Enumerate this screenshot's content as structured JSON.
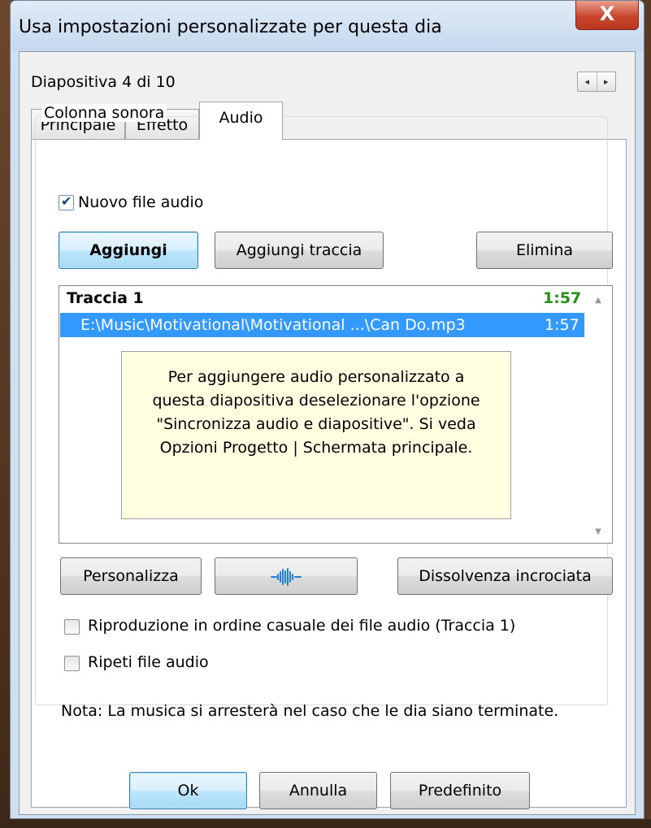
{
  "window": {
    "title": "Usa impostazioni personalizzate per questa dia",
    "close_glyph": "X"
  },
  "header": {
    "slide_counter": "Diapositiva 4 di 10",
    "prev_glyph": "◂",
    "next_glyph": "▸"
  },
  "tabs": [
    {
      "label": "Principale",
      "active": false
    },
    {
      "label": "Effetto",
      "active": false
    },
    {
      "label": "Audio",
      "active": true
    }
  ],
  "soundtrack": {
    "group_label": "Colonna sonora",
    "new_audio_checkbox": {
      "label": "Nuovo file audio",
      "checked": true
    },
    "buttons": {
      "add": "Aggiungi",
      "add_track": "Aggiungi traccia",
      "delete": "Elimina"
    },
    "list": {
      "track_name": "Traccia 1",
      "track_duration": "1:57",
      "file_path": "E:\\Music\\Motivational\\Motivational ...\\Can Do.mp3",
      "file_duration": "1:57"
    },
    "info_note_lines": [
      "Per aggiungere audio personalizzato a",
      "questa diapositiva deselezionare l'opzione",
      "\"Sincronizza audio e diapositive\". Si veda",
      "Opzioni Progetto | Schermata principale."
    ],
    "lower_buttons": {
      "customize": "Personalizza",
      "waveform_icon": "waveform-icon",
      "crossfade": "Dissolvenza incrociata"
    },
    "shuffle_checkbox": {
      "label": "Riproduzione in ordine casuale dei file audio (Traccia 1)",
      "checked": false
    },
    "repeat_checkbox": {
      "label": "Ripeti file audio",
      "checked": false
    },
    "note": "Nota: La musica si arresterà nel caso che le dia siano terminate."
  },
  "footer": {
    "ok": "Ok",
    "cancel": "Annulla",
    "default": "Predefinito"
  },
  "colors": {
    "selection": "#3399ff",
    "duration_green": "#268f16",
    "note_background": "#ffffe1",
    "close_red": "#c9452e"
  }
}
